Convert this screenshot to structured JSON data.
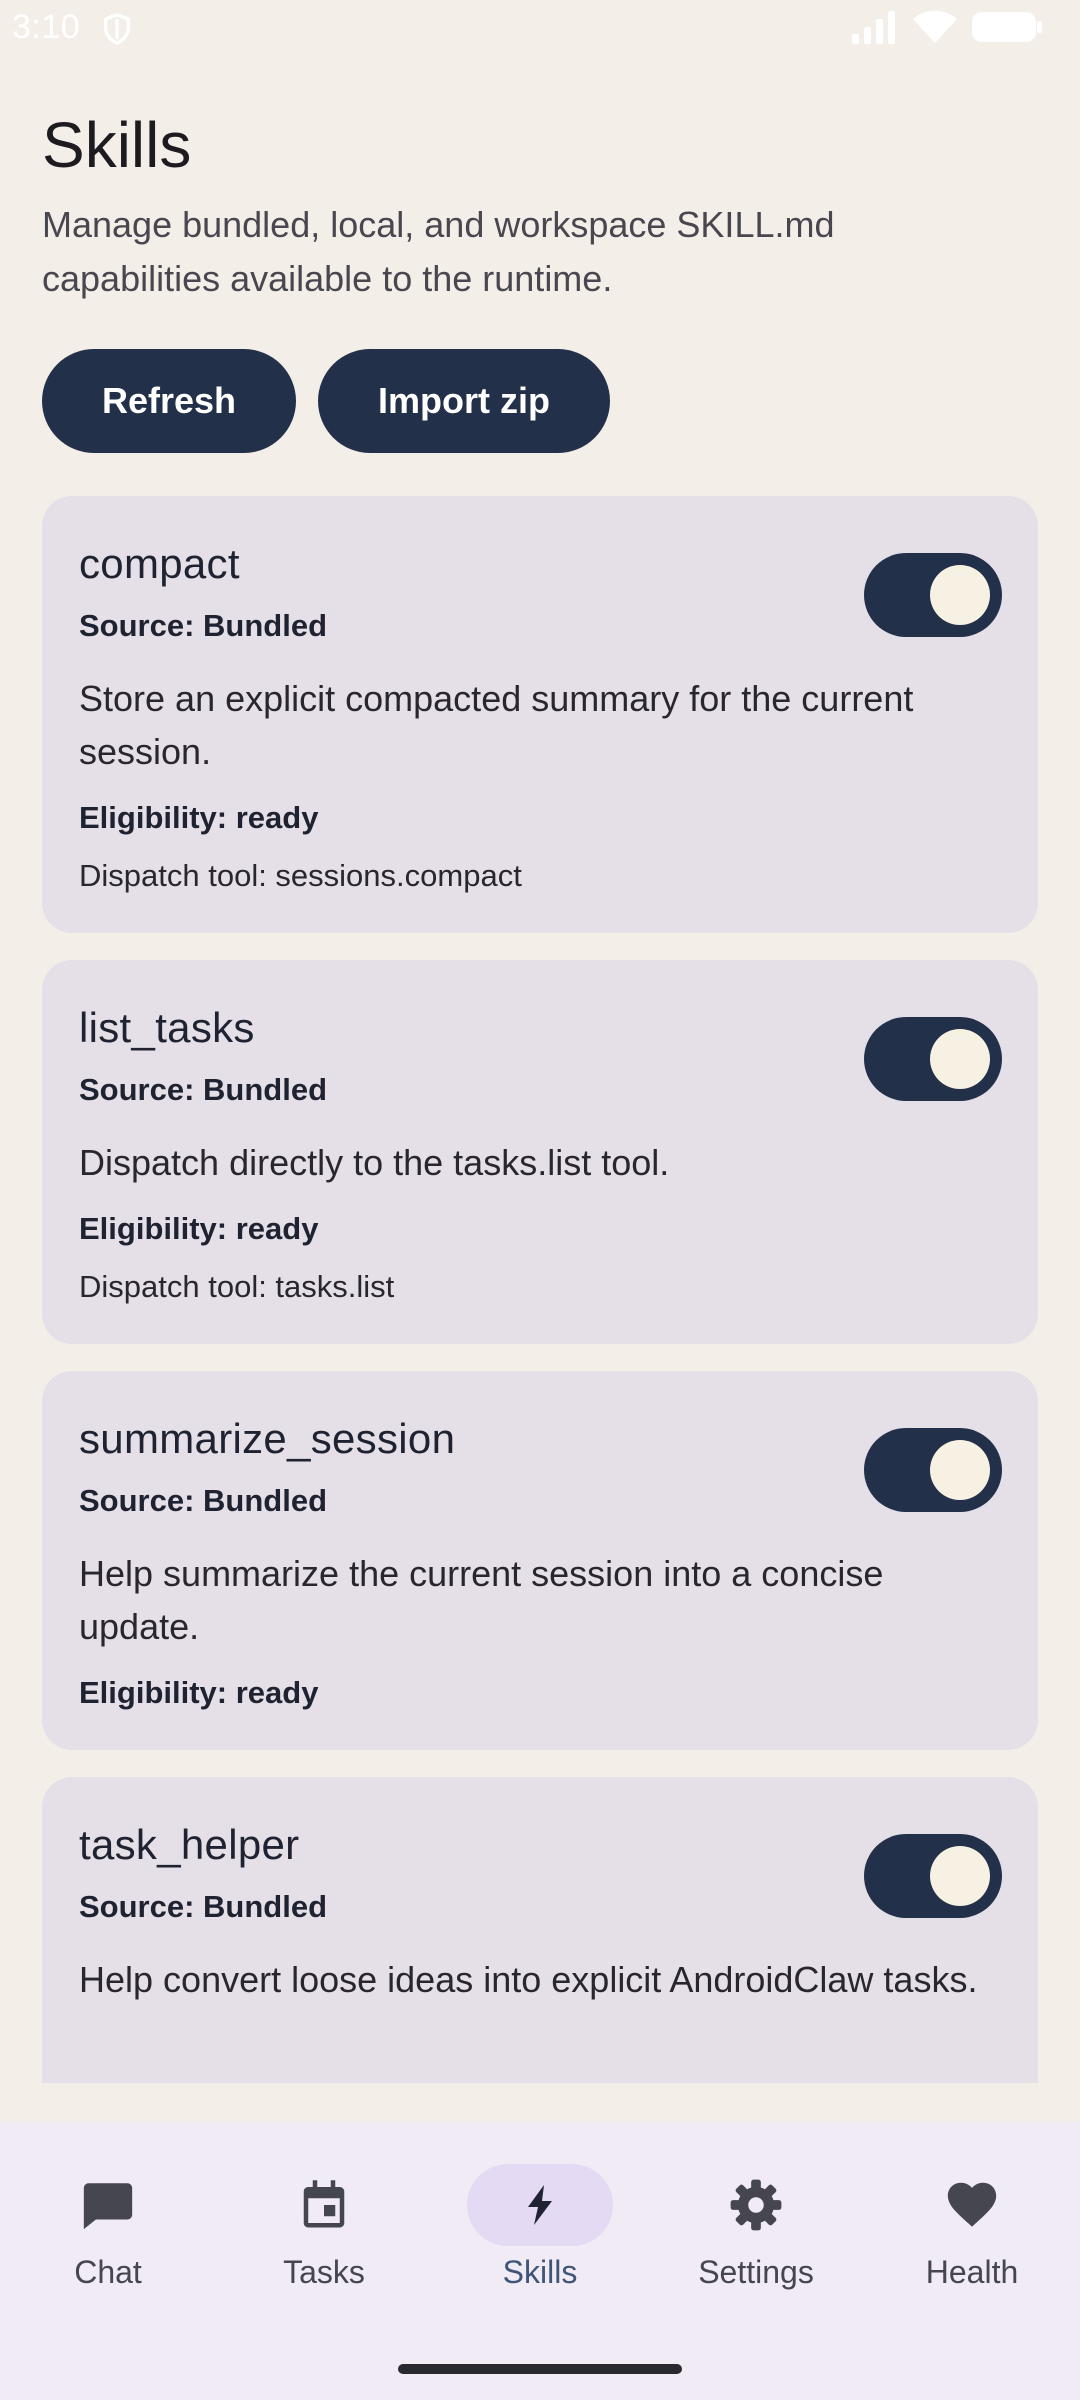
{
  "status": {
    "time": "3:10"
  },
  "header": {
    "title": "Skills",
    "subtitle": "Manage bundled, local, and workspace SKILL.md capabilities available to the runtime."
  },
  "actions": {
    "refresh": "Refresh",
    "import": "Import zip"
  },
  "skills": [
    {
      "name": "compact",
      "source": "Source: Bundled",
      "description": "Store an explicit compacted summary for the current session.",
      "eligibility": "Eligibility: ready",
      "dispatch": "Dispatch tool: sessions.compact",
      "enabled": true
    },
    {
      "name": "list_tasks",
      "source": "Source: Bundled",
      "description": "Dispatch directly to the tasks.list tool.",
      "eligibility": "Eligibility: ready",
      "dispatch": "Dispatch tool: tasks.list",
      "enabled": true
    },
    {
      "name": "summarize_session",
      "source": "Source: Bundled",
      "description": "Help summarize the current session into a concise update.",
      "eligibility": "Eligibility: ready",
      "enabled": true
    },
    {
      "name": "task_helper",
      "source": "Source: Bundled",
      "description": "Help convert loose ideas into explicit AndroidClaw tasks.",
      "enabled": true
    }
  ],
  "nav": [
    {
      "label": "Chat",
      "icon": "chat-icon"
    },
    {
      "label": "Tasks",
      "icon": "calendar-icon"
    },
    {
      "label": "Skills",
      "icon": "bolt-icon",
      "active": true
    },
    {
      "label": "Settings",
      "icon": "gear-icon"
    },
    {
      "label": "Health",
      "icon": "heart-icon"
    }
  ],
  "colors": {
    "background": "#f3efe8",
    "primary": "#233049",
    "card": "#e5e0e8",
    "nav_background": "#f0ebf5",
    "nav_active_pill": "#e4daf3"
  }
}
